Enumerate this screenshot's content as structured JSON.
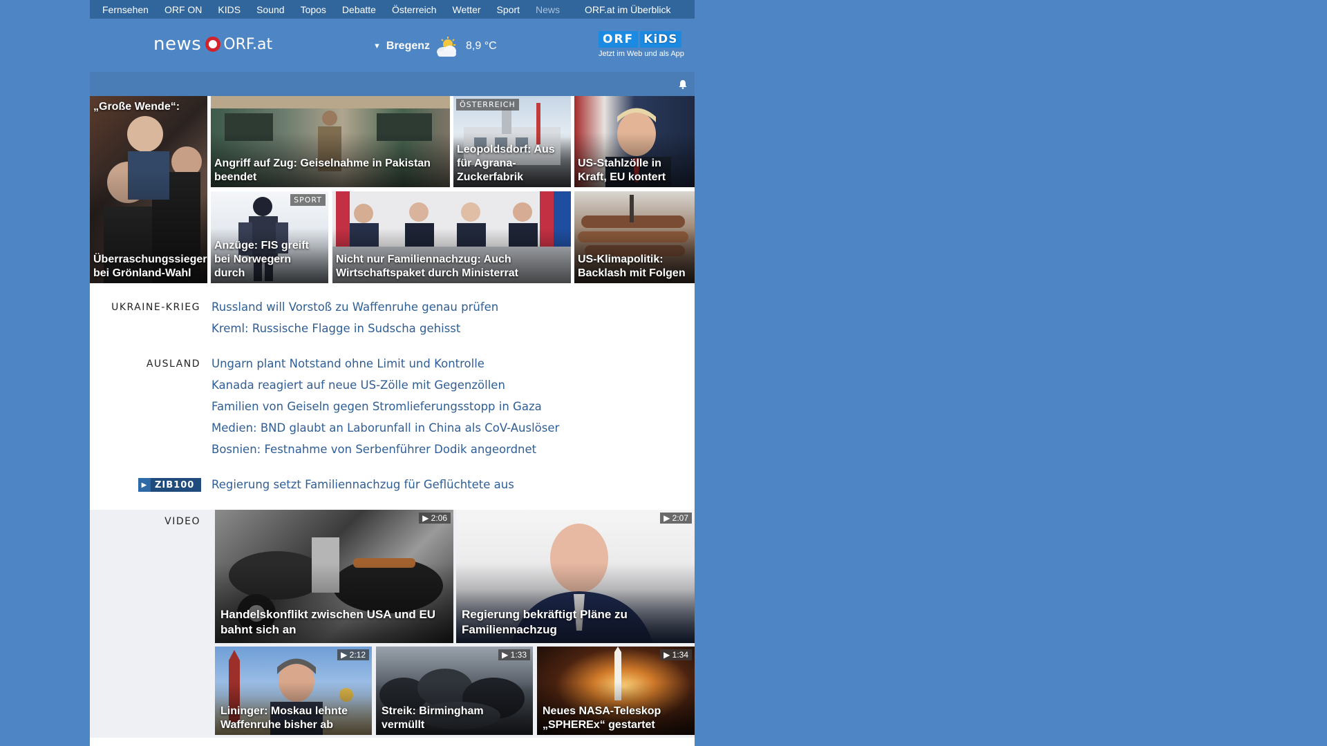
{
  "nav": {
    "items": [
      {
        "label": "Fernsehen"
      },
      {
        "label": "ORF ON"
      },
      {
        "label": "KIDS"
      },
      {
        "label": "Sound"
      },
      {
        "label": "Topos"
      },
      {
        "label": "Debatte"
      },
      {
        "label": "Österreich"
      },
      {
        "label": "Wetter"
      },
      {
        "label": "Sport"
      },
      {
        "label": "News"
      }
    ],
    "overview": "ORF.at im Überblick"
  },
  "header": {
    "logo_news": "news",
    "logo_orf": "ORF.at",
    "weather_city": "Bregenz",
    "weather_temp": "8,9 °C",
    "kids_badge_orf": "ORF",
    "kids_badge_kids": "KiDS",
    "kids_tagline": "Jetzt im Web und als App"
  },
  "teasers": [
    {
      "caption": "„Große Wende“:",
      "caption2": "Überraschungssieger bei Grönland-Wahl"
    },
    {
      "caption": "Angriff auf Zug: Geiselnahme in Pakistan beendet"
    },
    {
      "label": "ÖSTERREICH",
      "caption": "Leopoldsdorf: Aus für Agrana-Zuckerfabrik"
    },
    {
      "caption": "US-Stahlzölle in Kraft, EU kontert"
    },
    {
      "label": "SPORT",
      "caption": "Anzüge: FIS greift bei Norwegern durch"
    },
    {
      "caption": "Nicht nur Familiennachzug: Auch Wirtschaftspaket durch Ministerrat"
    },
    {
      "caption": "US-Klimapolitik: Backlash mit Folgen"
    }
  ],
  "sections": {
    "ukraine": {
      "label": "UKRAINE-KRIEG",
      "stories": [
        "Russland will Vorstoß zu Waffenruhe genau prüfen",
        "Kreml: Russische Flagge in Sudscha gehisst"
      ]
    },
    "ausland": {
      "label": "AUSLAND",
      "stories": [
        "Ungarn plant Notstand ohne Limit und Kontrolle",
        "Kanada reagiert auf neue US-Zölle mit Gegenzöllen",
        "Familien von Geiseln gegen Stromlieferungsstopp in Gaza",
        "Medien: BND glaubt an Laborunfall in China als CoV-Auslöser",
        "Bosnien: Festnahme von Serbenführer Dodik angeordnet"
      ]
    },
    "zib": {
      "badge": "ZIB100",
      "story": "Regierung setzt Familiennachzug für Geflüchtete aus"
    }
  },
  "video": {
    "label": "VIDEO",
    "items": [
      {
        "duration": "▶ 2:06",
        "caption": "Handelskonflikt zwischen USA und EU bahnt sich an"
      },
      {
        "duration": "▶ 2:07",
        "caption": "Regierung bekräftigt Pläne zu Familiennachzug"
      },
      {
        "duration": "▶ 2:12",
        "caption": "Lininger: Moskau lehnte Waffenruhe bisher ab"
      },
      {
        "duration": "▶ 1:33",
        "caption": "Streik: Birmingham vermüllt"
      },
      {
        "duration": "▶ 1:34",
        "caption": "Neues NASA-Teleskop „SPHEREx“ gestartet"
      }
    ]
  },
  "colors": {
    "background": "#4e86c5",
    "nav": "#30669c",
    "link": "#2f5e95",
    "orf_red": "#d2232a"
  }
}
